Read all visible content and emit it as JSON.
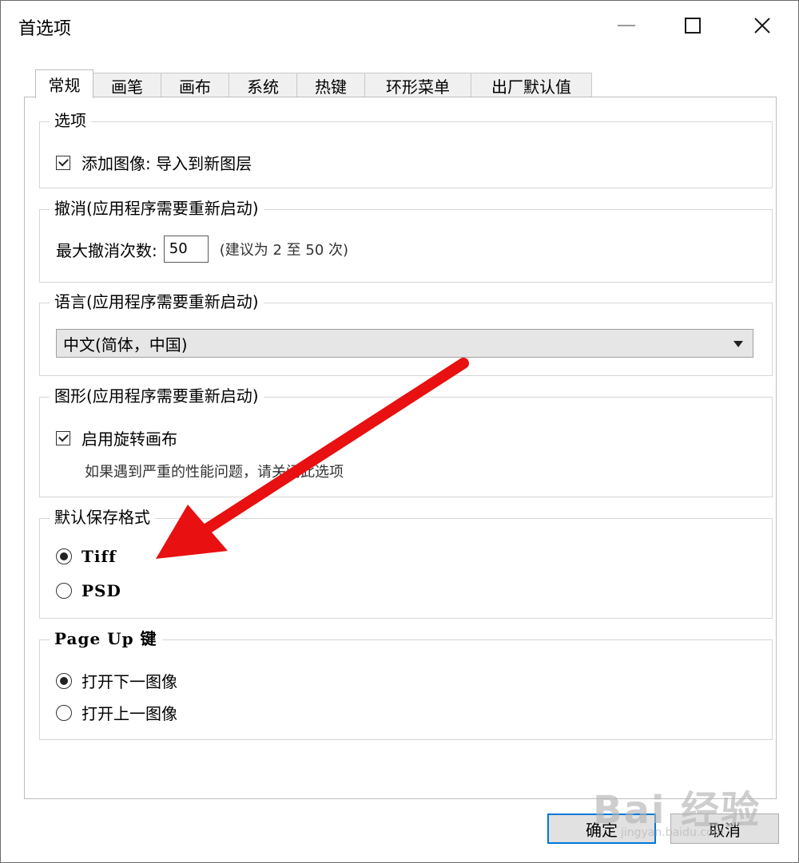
{
  "window": {
    "title": "首选项"
  },
  "tabs": [
    {
      "label": "常规",
      "active": true
    },
    {
      "label": "画笔"
    },
    {
      "label": "画布"
    },
    {
      "label": "系统"
    },
    {
      "label": "热键"
    },
    {
      "label": "环形菜单"
    },
    {
      "label": "出厂默认值"
    }
  ],
  "options": {
    "legend": "选项",
    "add_image": {
      "label": "添加图像: 导入到新图层",
      "checked": true
    }
  },
  "undo": {
    "legend": "撤消(应用程序需要重新启动)",
    "label": "最大撤消次数:",
    "value": "50",
    "hint": "(建议为 2 至 50 次)"
  },
  "language": {
    "legend": "语言(应用程序需要重新启动)",
    "selected": "中文(简体，中国)"
  },
  "graphics": {
    "legend": "图形(应用程序需要重新启动)",
    "rotate_canvas": {
      "label": "启用旋转画布",
      "checked": true
    },
    "note": "如果遇到严重的性能问题，请关闭此选项"
  },
  "save_format": {
    "legend": "默认保存格式",
    "options": [
      {
        "label": "Tiff",
        "selected": true
      },
      {
        "label": "PSD",
        "selected": false
      }
    ]
  },
  "page_up": {
    "legend": "Page Up 键",
    "options": [
      {
        "label": "打开下一图像",
        "selected": true
      },
      {
        "label": "打开上一图像",
        "selected": false
      }
    ]
  },
  "buttons": {
    "ok": "确定",
    "cancel": "取消"
  },
  "watermark": {
    "main": "Bai 经验",
    "sub": "jingyan.baidu.com"
  },
  "colors": {
    "accent": "#0078d7",
    "arrow": "#e81010"
  }
}
